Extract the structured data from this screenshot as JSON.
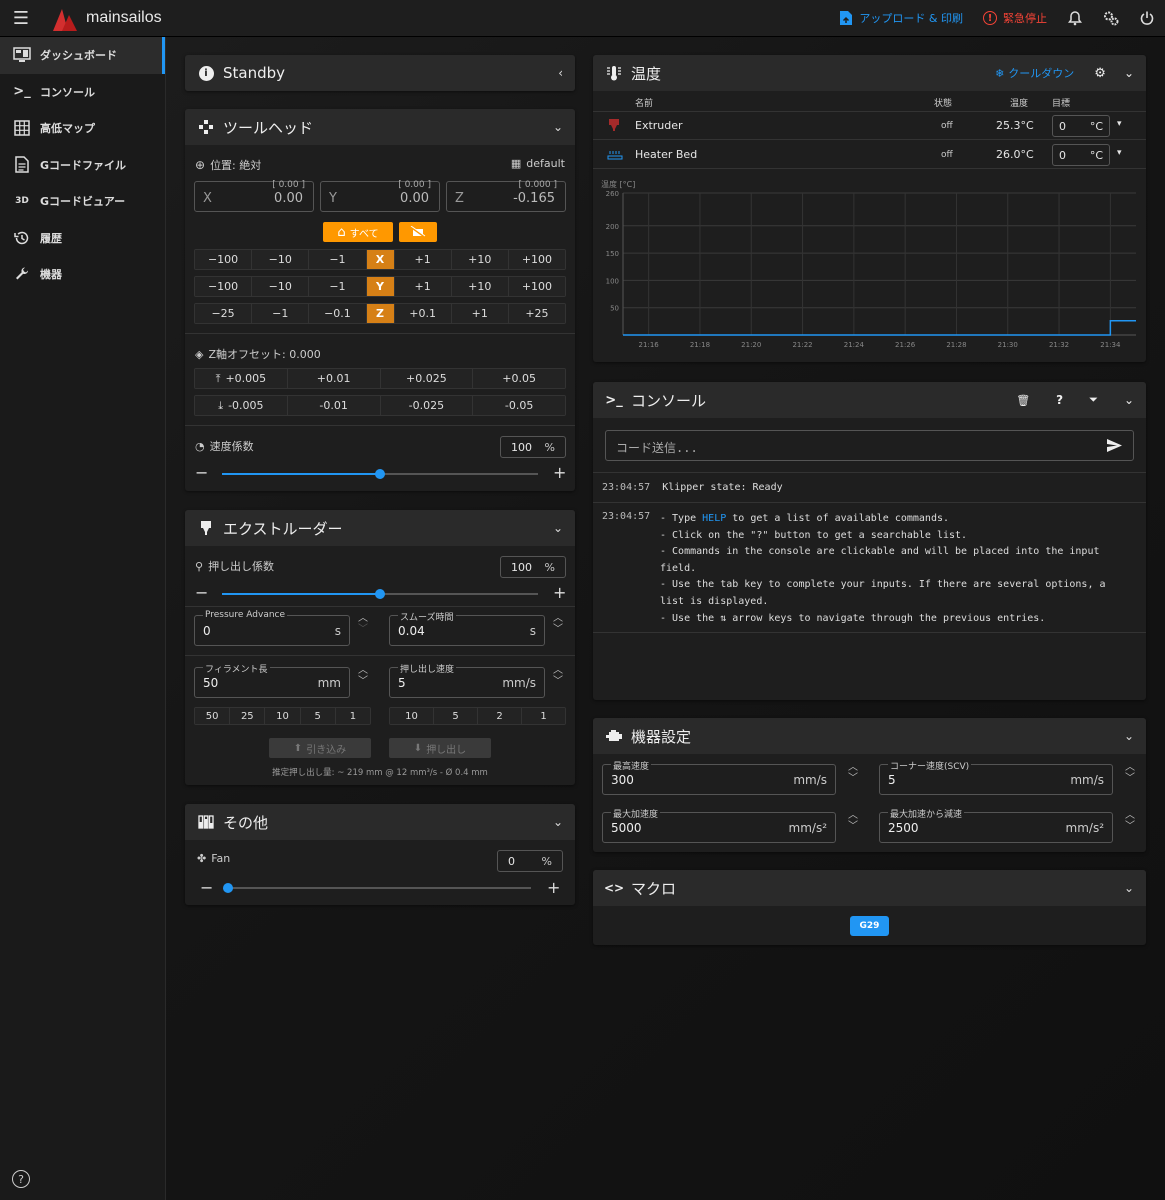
{
  "app": {
    "brand": "mainsailos",
    "upload_label": "アップロード & 印刷",
    "estop_label": "緊急停止"
  },
  "sidebar": {
    "items": [
      {
        "label": "ダッシュボード",
        "icon": "monitor-dashboard-icon"
      },
      {
        "label": "コンソール",
        "icon": "console-icon"
      },
      {
        "label": "高低マップ",
        "icon": "grid-icon"
      },
      {
        "label": "Gコードファイル",
        "icon": "file-document-icon"
      },
      {
        "label": "Gコードビュアー",
        "icon": "3d-icon",
        "icon_text": "3D"
      },
      {
        "label": "履歴",
        "icon": "history-icon"
      },
      {
        "label": "機器",
        "icon": "wrench-icon"
      }
    ]
  },
  "status": {
    "title": "Standby"
  },
  "toolhead": {
    "title": "ツールヘッド",
    "position_label": "位置: 絶対",
    "profile": "default",
    "axes": [
      {
        "label": "X",
        "value": "0.00",
        "target": "[ 0.00 ]"
      },
      {
        "label": "Y",
        "value": "0.00",
        "target": "[ 0.00 ]"
      },
      {
        "label": "Z",
        "value": "-0.165",
        "target": "[ 0.000 ]"
      }
    ],
    "home_all": "すべて",
    "jog_x": [
      "−100",
      "−10",
      "−1",
      "X",
      "+1",
      "+10",
      "+100"
    ],
    "jog_y": [
      "−100",
      "−10",
      "−1",
      "Y",
      "+1",
      "+10",
      "+100"
    ],
    "jog_z": [
      "−25",
      "−1",
      "−0.1",
      "Z",
      "+0.1",
      "+1",
      "+25"
    ],
    "zoffset_label": "Z軸オフセット: 0.000",
    "zup": [
      "+0.005",
      "+0.01",
      "+0.025",
      "+0.05"
    ],
    "zdown": [
      "-0.005",
      "-0.01",
      "-0.025",
      "-0.05"
    ],
    "speed_label": "速度係数",
    "speed_value": "100",
    "speed_unit": "%",
    "speed_fraction": 0.5
  },
  "extruder": {
    "title": "エクストルーダー",
    "flow_label": "押し出し係数",
    "flow_value": "100",
    "flow_unit": "%",
    "flow_fraction": 0.5,
    "pa_label": "Pressure Advance",
    "pa_value": "0",
    "pa_unit": "s",
    "smooth_label": "スムーズ時間",
    "smooth_value": "0.04",
    "smooth_unit": "s",
    "len_label": "フィラメント長",
    "len_value": "50",
    "len_unit": "mm",
    "feed_label": "押し出し速度",
    "feed_value": "5",
    "feed_unit": "mm/s",
    "len_presets": [
      "50",
      "25",
      "10",
      "5",
      "1"
    ],
    "feed_presets": [
      "10",
      "5",
      "2",
      "1"
    ],
    "retract": "引き込み",
    "extrude": "押し出し",
    "estimate": "推定押し出し量: ~ 219 mm @ 12 mm³/s - Ø 0.4 mm"
  },
  "misc": {
    "title": "その他",
    "fan_label": "Fan",
    "fan_value": "0",
    "fan_unit": "%",
    "fan_fraction": 0.0
  },
  "temperature": {
    "title": "温度",
    "cooldown": "クールダウン",
    "headers": {
      "name": "名前",
      "state": "状態",
      "temp": "温度",
      "target": "目標"
    },
    "rows": [
      {
        "name": "Extruder",
        "state": "off",
        "temp": "25.3°C",
        "target": "0",
        "unit": "°C",
        "color": "#a52a2a"
      },
      {
        "name": "Heater Bed",
        "state": "off",
        "temp": "26.0°C",
        "target": "0",
        "unit": "°C",
        "color": "#2196f3"
      }
    ]
  },
  "chart_data": {
    "type": "line",
    "ylabel": "温度 [°C]",
    "ylim": [
      0,
      260
    ],
    "yticks": [
      "260",
      "200",
      "150",
      "100",
      "50"
    ],
    "xticks": [
      "21:16",
      "21:18",
      "21:20",
      "21:22",
      "21:24",
      "21:26",
      "21:28",
      "21:30",
      "21:32",
      "21:34"
    ],
    "series": [
      {
        "name": "Heater Bed",
        "x": [
          "21:15",
          "21:34",
          "21:34",
          "21:35"
        ],
        "values": [
          0,
          0,
          26,
          26
        ]
      }
    ]
  },
  "console": {
    "title": "コンソール",
    "placeholder": "コード送信...",
    "entries": [
      {
        "time": "23:04:57",
        "lines": [
          "Klipper state: Ready"
        ]
      },
      {
        "time": "23:04:57",
        "lines": [
          "- Type HELP to get a list of available commands.",
          "- Click on the \"?\" button to get a searchable list.",
          "- Commands in the console are clickable and will be placed into the input",
          "field.",
          "- Use the tab key to complete your inputs. If there are several options, a",
          "list is displayed.",
          "- Use the ⇅ arrow keys to navigate through the previous entries."
        ]
      }
    ]
  },
  "machine": {
    "title": "機器設定",
    "fields": [
      {
        "label": "最高速度",
        "value": "300",
        "unit": "mm/s"
      },
      {
        "label": "コーナー速度(SCV)",
        "value": "5",
        "unit": "mm/s"
      },
      {
        "label": "最大加速度",
        "value": "5000",
        "unit": "mm/s²"
      },
      {
        "label": "最大加速から減速",
        "value": "2500",
        "unit": "mm/s²"
      }
    ]
  },
  "macros": {
    "title": "マクロ",
    "buttons": [
      "G29"
    ]
  }
}
